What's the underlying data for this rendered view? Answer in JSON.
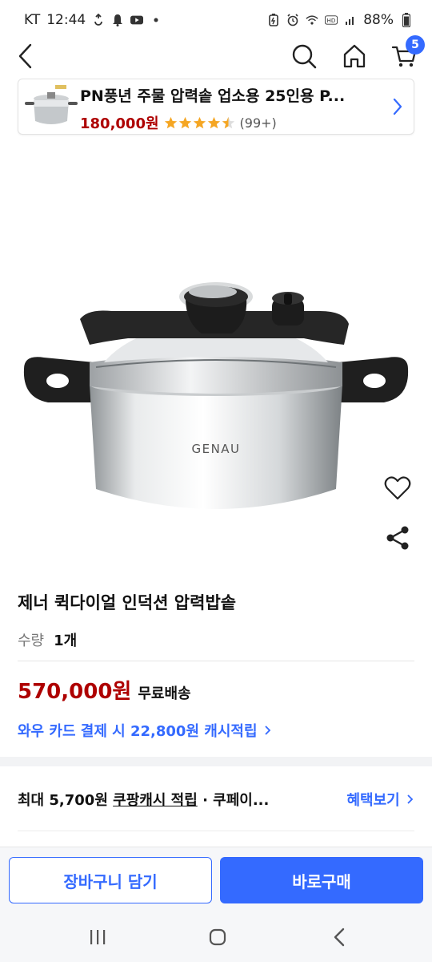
{
  "status_bar": {
    "carrier": "KT",
    "time": "12:44",
    "battery": "88%"
  },
  "top_nav": {
    "cart_count": "5"
  },
  "recommended": {
    "title": "PN풍년 주물 압력솥 업소용 25인용 P...",
    "price": "180,000원",
    "rating": 4.5,
    "review_count": "(99+)"
  },
  "product": {
    "brand_on_image": "GENAU",
    "title": "제너 퀵다이얼 인덕션 압력밥솥",
    "quantity_label": "수량",
    "quantity_value": "1개",
    "price": "570,000원",
    "shipping": "무료배송",
    "wow_card": "와우 카드 결제 시 22,800원 캐시적립",
    "benefit_prefix": "최대 5,700원 ",
    "benefit_underlined": "쿠팡캐시 적립",
    "benefit_suffix": " · 쿠페이...",
    "benefit_link": "혜택보기"
  },
  "actions": {
    "add_to_cart": "장바구니 담기",
    "buy_now": "바로구매"
  },
  "colors": {
    "accent": "#346aff",
    "price_red": "#ae0000"
  },
  "icons": [
    "back-icon",
    "search-icon",
    "home-icon",
    "cart-icon",
    "heart-icon",
    "share-icon",
    "chevron-right-icon",
    "star-icon"
  ]
}
